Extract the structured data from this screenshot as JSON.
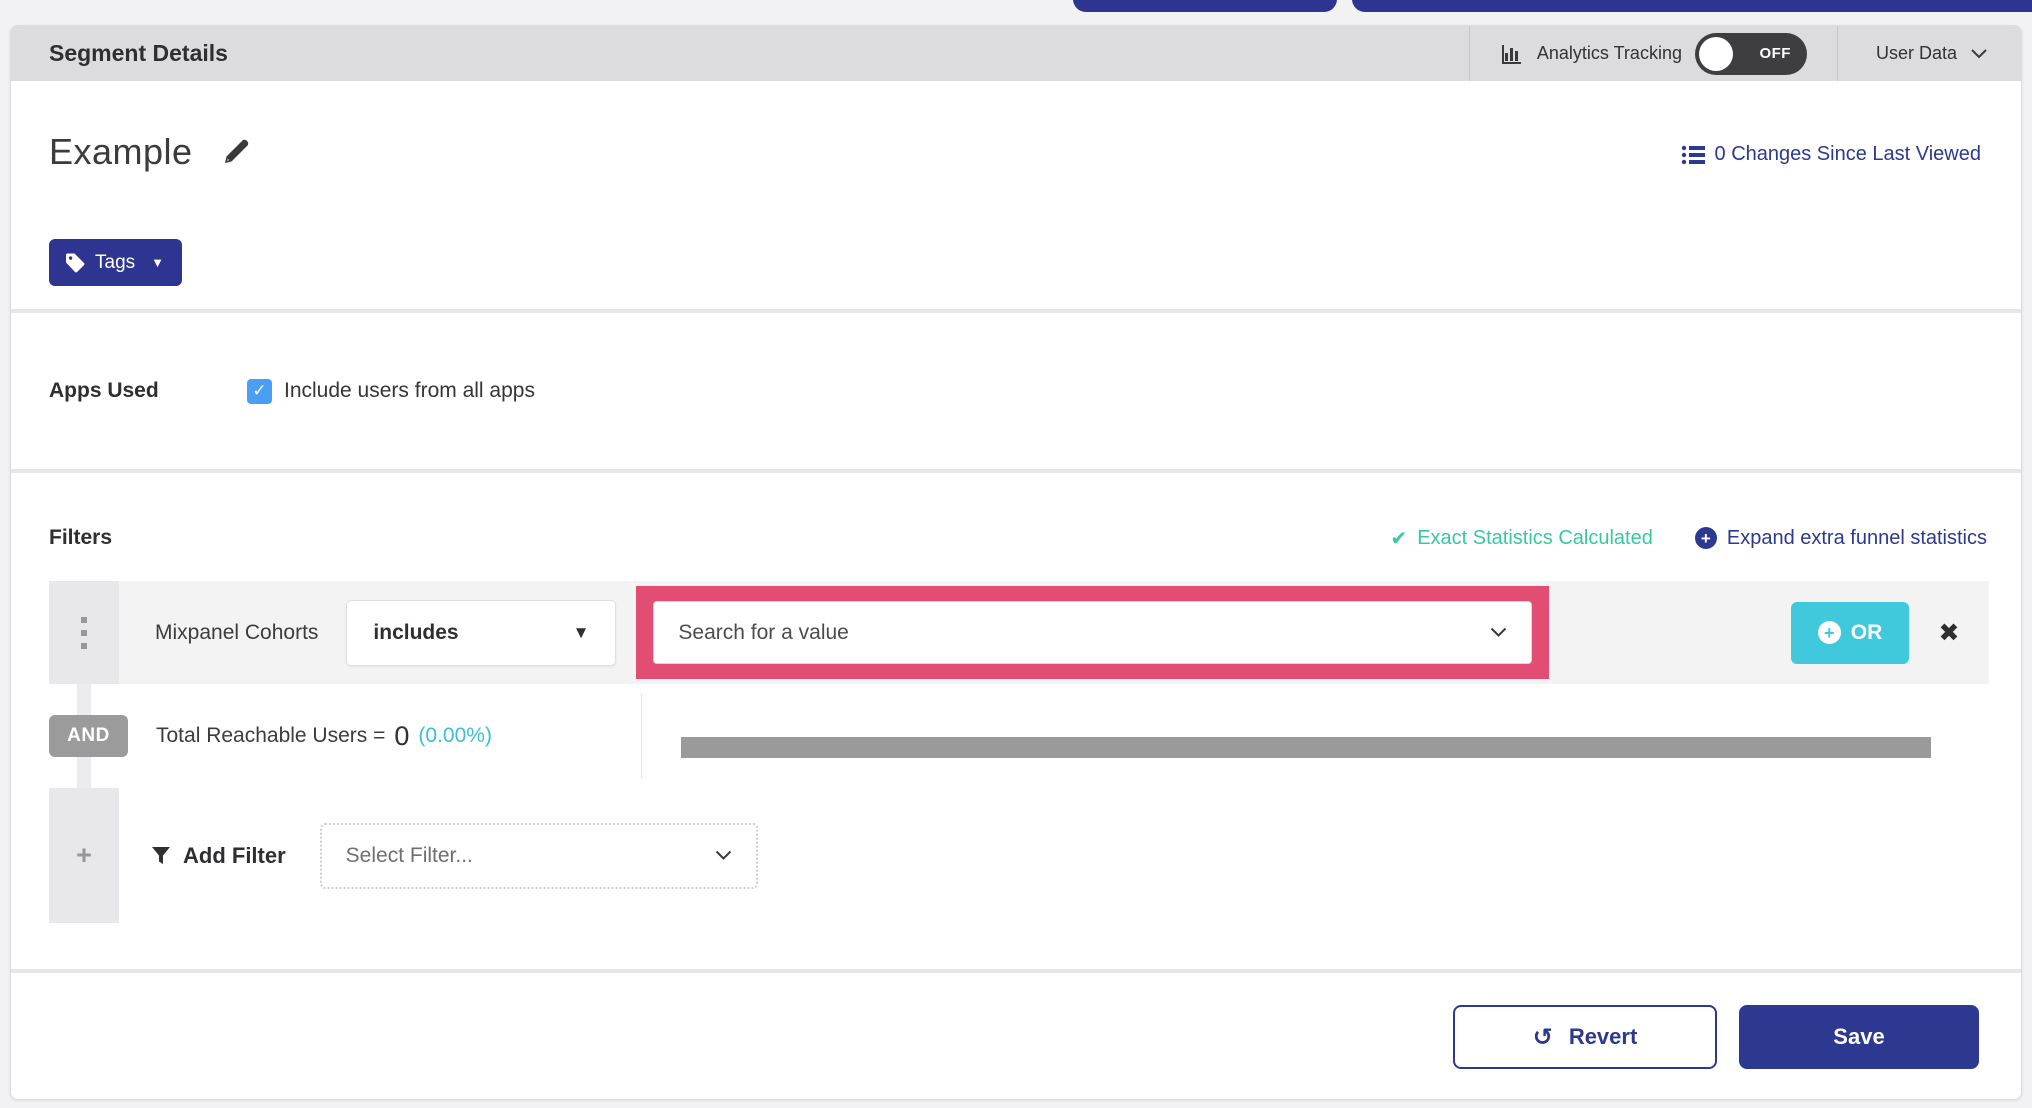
{
  "header": {
    "title": "Segment Details",
    "analytics_label": "Analytics Tracking",
    "toggle_state": "OFF",
    "user_data_label": "User Data"
  },
  "title_bar": {
    "segment_name": "Example",
    "changes_link": "0 Changes Since Last Viewed",
    "tags_label": "Tags"
  },
  "apps_used": {
    "label": "Apps Used",
    "checkbox_checked": true,
    "checkbox_glyph": "✓",
    "checkbox_label": "Include users from all apps"
  },
  "filters": {
    "heading": "Filters",
    "exact_stats_label": "Exact Statistics Calculated",
    "exact_stats_icon": "✔",
    "expand_link": "Expand extra funnel statistics",
    "row": {
      "field": "Mixpanel Cohorts",
      "operator": "includes",
      "operator_caret": "▼",
      "value_placeholder": "Search for a value",
      "or_label": "OR",
      "close_glyph": "✖"
    },
    "and_label": "AND",
    "reachable": {
      "prefix": "Total Reachable Users =",
      "count": "0",
      "percent": "(0.00%)"
    },
    "add_filter": {
      "plus_glyph": "+",
      "label": "Add Filter",
      "placeholder": "Select Filter..."
    }
  },
  "footer": {
    "revert_label": "Revert",
    "revert_icon": "↺",
    "save_label": "Save"
  },
  "colors": {
    "accent_indigo": "#2d3890",
    "highlight_pink": "#e24d73",
    "teal_success": "#37c99e",
    "cyan_accent": "#40c9dc",
    "checkbox_blue": "#4a9ff5",
    "band_gray": "#dcdcdf",
    "bar_gray": "#9a9a9a"
  }
}
